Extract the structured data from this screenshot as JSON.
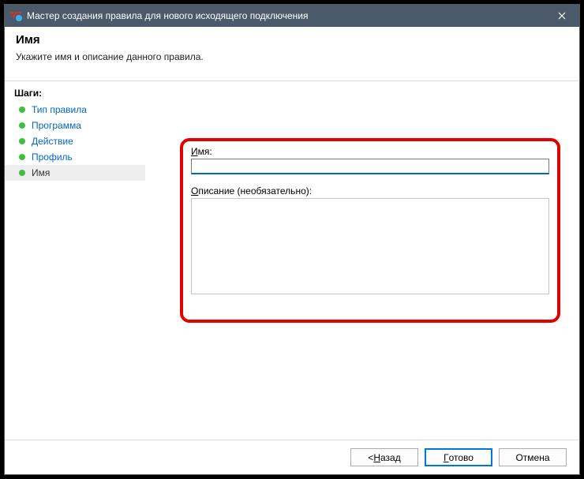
{
  "titlebar": {
    "title": "Мастер создания правила для нового исходящего подключения"
  },
  "header": {
    "title": "Имя",
    "description": "Укажите имя и описание данного правила."
  },
  "sidebar": {
    "title": "Шаги:",
    "steps": [
      {
        "label": "Тип правила"
      },
      {
        "label": "Программа"
      },
      {
        "label": "Действие"
      },
      {
        "label": "Профиль"
      },
      {
        "label": "Имя"
      }
    ]
  },
  "form": {
    "name_label_ul": "И",
    "name_label_rest": "мя:",
    "name_value": "",
    "desc_label_ul": "О",
    "desc_label_rest": "писание (необязательно):",
    "desc_value": ""
  },
  "footer": {
    "back_prefix": "< ",
    "back_ul": "Н",
    "back_rest": "азад",
    "finish_ul": "Г",
    "finish_rest": "отово",
    "cancel": "Отмена"
  }
}
